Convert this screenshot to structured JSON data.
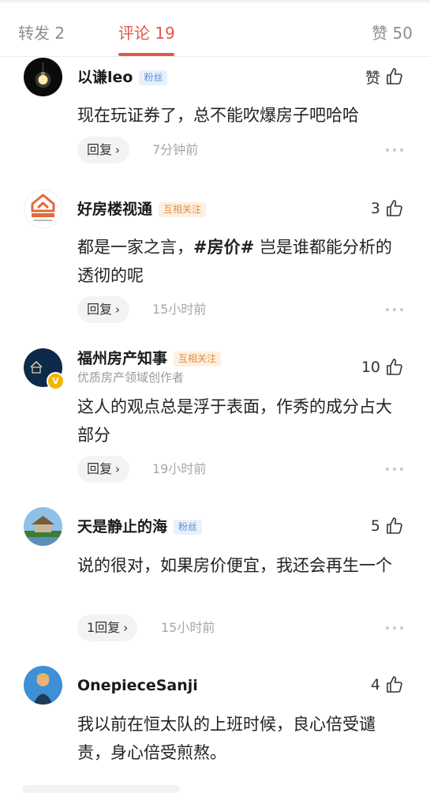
{
  "tabs": {
    "repost": "转发 2",
    "comments": "评论 19",
    "likes": "赞 50"
  },
  "comments": [
    {
      "name": "以谦leo",
      "badge": "粉丝",
      "like_label": "赞",
      "text": "现在玩证券了，总不能吹爆房子吧哈哈",
      "reply_label": "回复",
      "time": "7分钟前"
    },
    {
      "name": "好房楼视通",
      "badge": "互相关注",
      "like_count": "3",
      "text_before": "都是一家之言，",
      "hashtag": "#房价#",
      "text_after": " 岂是谁都能分析的透彻的呢",
      "reply_label": "回复",
      "time": "15小时前",
      "avatar_logo": "好房楼视通"
    },
    {
      "name": "福州房产知事",
      "badge": "互相关注",
      "subtitle": "优质房产领域创作者",
      "like_count": "10",
      "text": "这人的观点总是浮于表面，作秀的成分占大部分",
      "reply_label": "回复",
      "time": "19小时前",
      "avatar_logo": "房产知事",
      "verified_mark": "V"
    },
    {
      "name": "天是静止的海",
      "badge": "粉丝",
      "like_count": "5",
      "text": "说的很对，如果房价便宜，我还会再生一个",
      "reply_label": "1回复",
      "time": "15小时前"
    },
    {
      "name": "OnepieceSanji",
      "like_count": "4",
      "text": "我以前在恒太队的上班时候，良心倍受谴责，身心倍受煎熬。"
    }
  ],
  "icons": {
    "thumb": "thumbs-up-icon",
    "chevron": "chevron-right-icon",
    "more": "more-dots-icon"
  },
  "colors": {
    "accent": "#e2574c",
    "fan_badge": "#5c8fd6",
    "mutual_badge": "#e28f3a",
    "verified": "#f4b400"
  }
}
